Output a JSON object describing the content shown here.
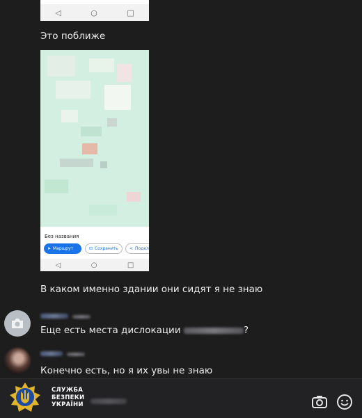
{
  "messages": {
    "text_1": "Это поближе",
    "text_2": "В каком именно здании они сидят я не знаю",
    "text_3_prefix": "Еще есть места дислокации",
    "text_3_suffix": "?",
    "text_4": "Конечно есть, но я их увы не знаю"
  },
  "map_screenshot": {
    "place_title": "Без названия",
    "route_label": "Маршрут",
    "save_label": "Сохранить",
    "share_label": "Подел"
  },
  "nav_icons": [
    "back-icon",
    "home-icon",
    "recents-icon"
  ],
  "watermark": {
    "line1": "СЛУЖБА",
    "line2": "БЕЗПЕКИ",
    "line3": "УКРАЇНИ"
  },
  "toolbar_icons": [
    "camera-icon",
    "emoji-icon"
  ],
  "colors": {
    "background": "#1d1d1e",
    "route_button": "#1a73e8",
    "map_green": "#cfeede",
    "logo_gold": "#e2b52a",
    "logo_blue": "#1f4ca3"
  }
}
